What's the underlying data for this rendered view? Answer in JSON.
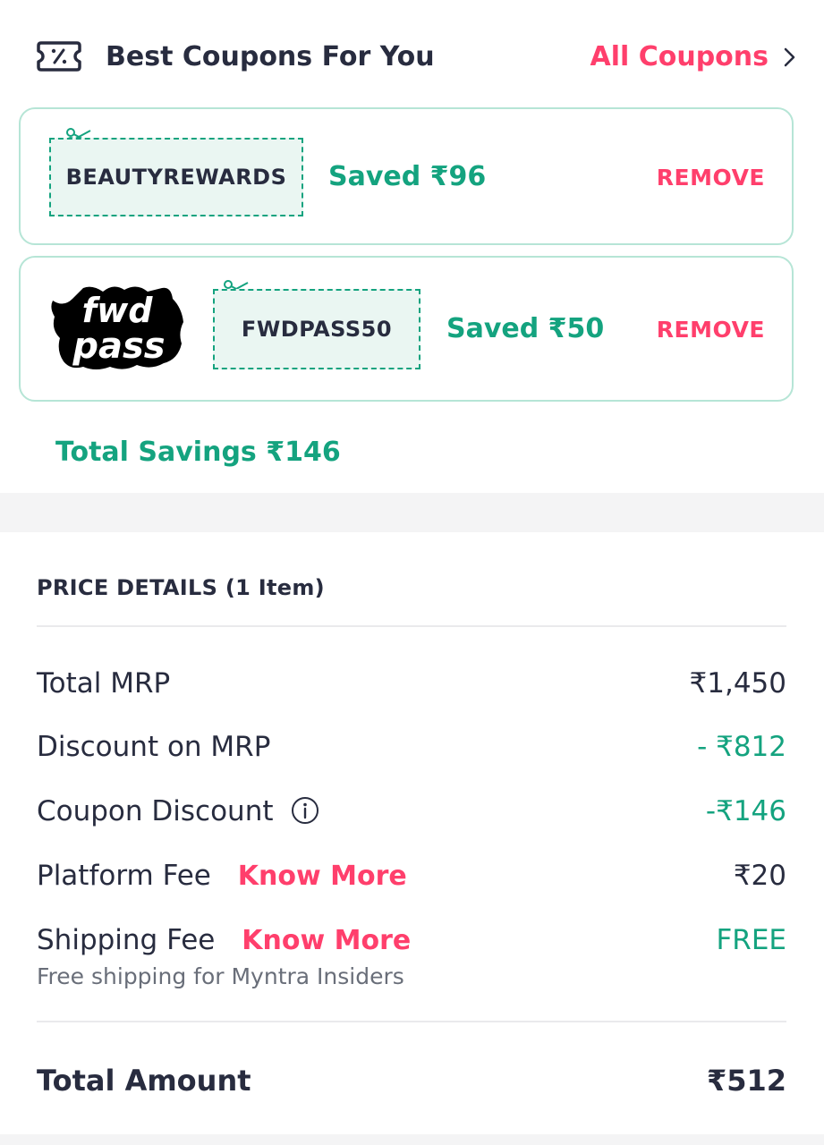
{
  "coupons_header": {
    "title": "Best Coupons For You",
    "all_coupons_label": "All Coupons"
  },
  "applied_coupons": [
    {
      "code": "BEAUTYREWARDS",
      "saved_text": "Saved ₹96",
      "remove_label": "REMOVE"
    },
    {
      "code": "FWDPASS50",
      "saved_text": "Saved ₹50",
      "remove_label": "REMOVE",
      "logo_text": [
        "fwd",
        "pass"
      ]
    }
  ],
  "total_savings": "Total Savings ₹146",
  "price_details": {
    "title": "PRICE DETAILS (1 Item)",
    "rows": [
      {
        "label": "Total MRP",
        "value": "₹1,450"
      },
      {
        "label": "Discount on MRP",
        "value": "- ₹812"
      },
      {
        "label": "Coupon Discount",
        "value": "-₹146"
      },
      {
        "label": "Platform Fee",
        "link": "Know More",
        "value": "₹20"
      },
      {
        "label": "Shipping Fee",
        "link": "Know More",
        "value": "FREE",
        "note": "Free shipping for Myntra Insiders"
      }
    ],
    "total_label": "Total Amount",
    "total_value": "₹512"
  },
  "colors": {
    "accent_pink": "#ff3f6c",
    "savings_green": "#14a37f",
    "text_dark": "#282c3f"
  }
}
